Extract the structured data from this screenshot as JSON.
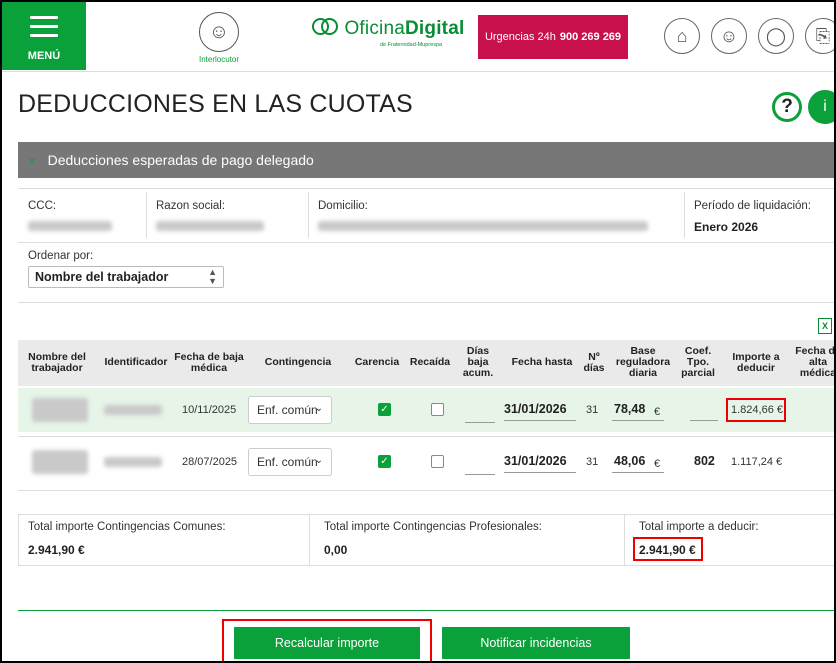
{
  "header": {
    "menu_label": "MENÚ",
    "interlocutor_label": "Interlocutor",
    "logo_main": "Oficina",
    "logo_bold": "Digital",
    "logo_sub": "de Fraternidad-Muprespa",
    "urgent_label": "Urgencias 24h",
    "urgent_phone": "900 269 269",
    "icons": [
      "home-icon",
      "user-icon",
      "headset-icon",
      "logout-icon"
    ]
  },
  "page": {
    "title": "DEDUCCIONES EN LAS CUOTAS",
    "help_glyph": "?",
    "info_glyph": "i"
  },
  "section": {
    "close_glyph": "×",
    "title": "Deducciones esperadas de pago delegado"
  },
  "filters": {
    "ccc_label": "CCC:",
    "razon_label": "Razon social:",
    "domicilio_label": "Domicilio:",
    "periodo_label": "Período de liquidación:",
    "periodo_value": "Enero 2026",
    "ordenar_label": "Ordenar por:",
    "ordenar_value": "Nombre del trabajador"
  },
  "table": {
    "headers": {
      "nombre": "Nombre del trabajador",
      "identificador": "Identificador",
      "fecha_baja": "Fecha de baja médica",
      "contingencia": "Contingencia",
      "carencia": "Carencia",
      "recaida": "Recaída",
      "dias_baja": "Días baja acum.",
      "fecha_hasta": "Fecha hasta",
      "n_dias": "Nº días",
      "base": "Base reguladora diaria",
      "coef": "Coef. Tpo. parcial",
      "importe": "Importe a deducir",
      "fecha_alta": "Fecha de alta médica"
    },
    "rows": [
      {
        "fecha_baja": "10/11/2025",
        "contingencia": "Enf. común",
        "carencia": true,
        "recaida": false,
        "fecha_hasta": "31/01/2026",
        "n_dias": "31",
        "base": "78,48",
        "currency": "€",
        "coef": "",
        "importe": "1.824,66 €"
      },
      {
        "fecha_baja": "28/07/2025",
        "contingencia": "Enf. común",
        "carencia": true,
        "recaida": false,
        "fecha_hasta": "31/01/2026",
        "n_dias": "31",
        "base": "48,06",
        "currency": "€",
        "coef": "802",
        "importe": "1.117,24 €"
      }
    ]
  },
  "totals": {
    "comunes_label": "Total importe Contingencias Comunes:",
    "comunes_value": "2.941,90 €",
    "profesionales_label": "Total importe Contingencias Profesionales:",
    "profesionales_value": "0,00",
    "deducir_label": "Total importe a deducir:",
    "deducir_value": "2.941,90 €"
  },
  "actions": {
    "recalcular": "Recalcular importe",
    "notificar": "Notificar incidencias"
  },
  "colors": {
    "brand_green": "#0aa13a",
    "urgent": "#c8104b",
    "highlight": "#e00000"
  }
}
